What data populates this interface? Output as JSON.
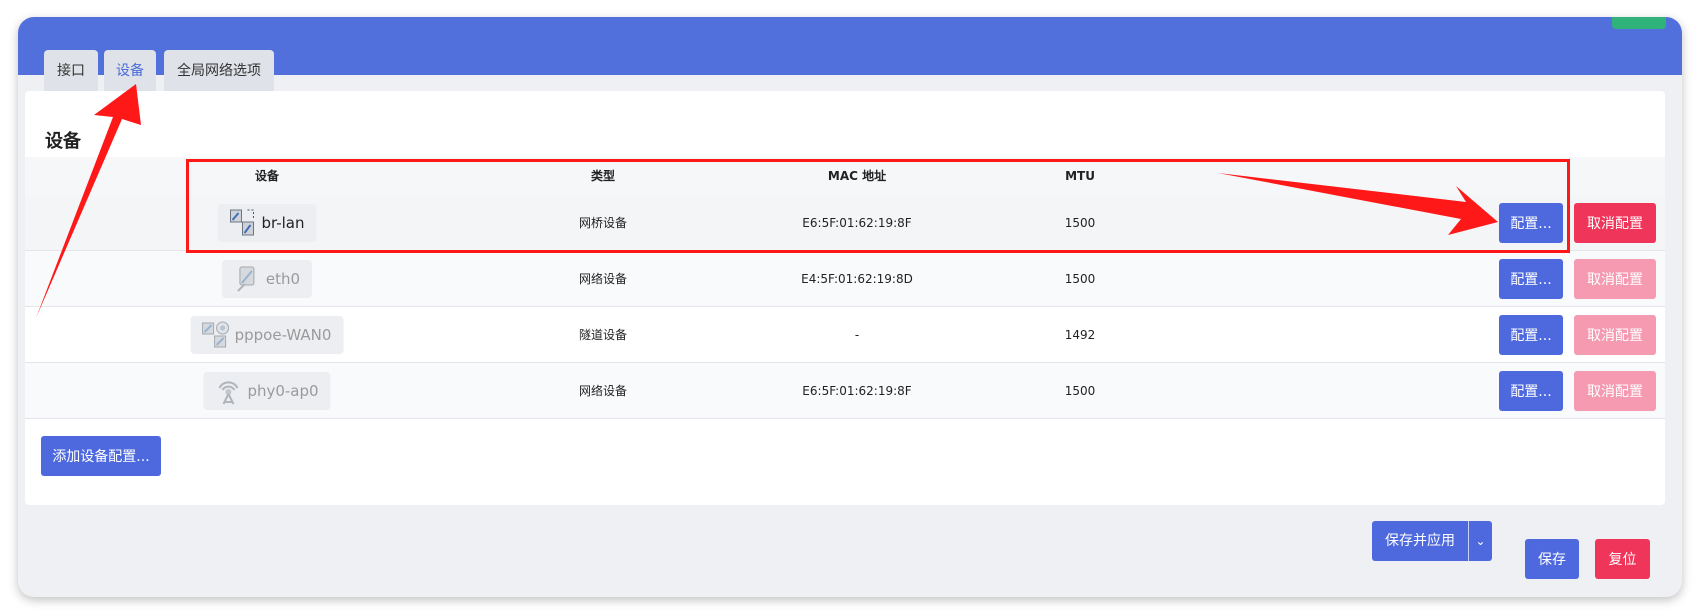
{
  "tabs": [
    {
      "label": "接口"
    },
    {
      "label": "设备"
    },
    {
      "label": "全局网络选项"
    }
  ],
  "active_tab": "设备",
  "section": {
    "title": "设备"
  },
  "table": {
    "columns": [
      "设备",
      "类型",
      "MAC 地址",
      "MTU"
    ],
    "rows": [
      {
        "device": "br-lan",
        "type": "网桥设备",
        "mac": "E6:5F:01:62:19:8F",
        "mtu": "1500",
        "icon": "bridge-icon",
        "configure": "配置...",
        "unconfigure": "取消配置",
        "unconfigure_enabled": true
      },
      {
        "device": "eth0",
        "type": "网络设备",
        "mac": "E4:5F:01:62:19:8D",
        "mtu": "1500",
        "icon": "ethernet-port-icon",
        "configure": "配置...",
        "unconfigure": "取消配置",
        "unconfigure_enabled": false
      },
      {
        "device": "pppoe-WAN0",
        "type": "隧道设备",
        "mac": "-",
        "mtu": "1492",
        "icon": "tunnel-icon",
        "configure": "配置...",
        "unconfigure": "取消配置",
        "unconfigure_enabled": false
      },
      {
        "device": "phy0-ap0",
        "type": "网络设备",
        "mac": "E6:5F:01:62:19:8F",
        "mtu": "1500",
        "icon": "wireless-icon",
        "configure": "配置...",
        "unconfigure": "取消配置",
        "unconfigure_enabled": false
      }
    ]
  },
  "add_button": {
    "label": "添加设备配置..."
  },
  "footer": {
    "save_apply": "保存并应用",
    "save": "保存",
    "reset": "复位"
  },
  "colors": {
    "header": "#5270dc",
    "primary": "#4e69de",
    "danger": "#f0355a",
    "danger_disabled": "#f59ab0",
    "annotation": "#ff1818"
  }
}
